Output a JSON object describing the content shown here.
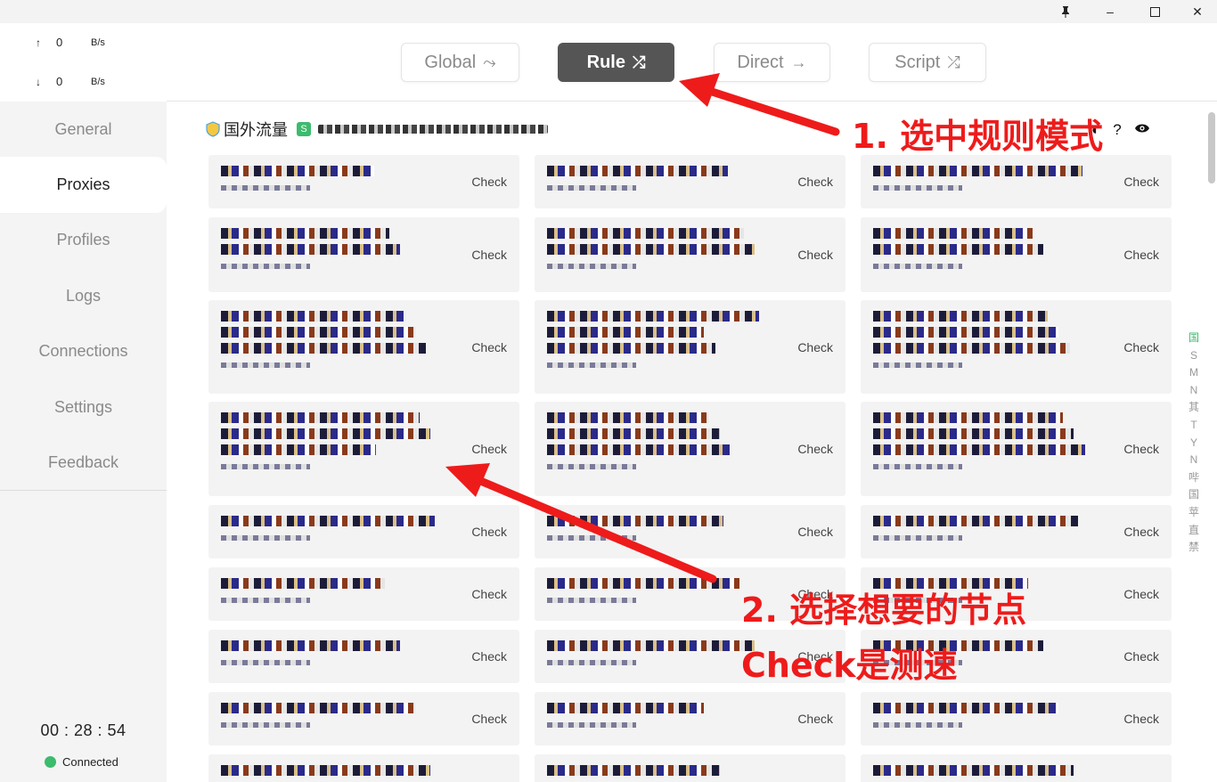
{
  "window": {
    "controls": {
      "pin": "📌",
      "minimize": "–",
      "maximize": "☐",
      "close": "✕"
    }
  },
  "traffic": {
    "up": {
      "arrow": "↑",
      "value": "0",
      "unit": "B/s"
    },
    "down": {
      "arrow": "↓",
      "value": "0",
      "unit": "B/s"
    }
  },
  "sidebar": {
    "items": [
      {
        "label": "General"
      },
      {
        "label": "Proxies"
      },
      {
        "label": "Profiles"
      },
      {
        "label": "Logs"
      },
      {
        "label": "Connections"
      },
      {
        "label": "Settings"
      },
      {
        "label": "Feedback"
      }
    ],
    "active": "Proxies",
    "timer": "00 : 28 : 54",
    "status": "Connected"
  },
  "modes": [
    {
      "label": "Global",
      "icon": "⤳"
    },
    {
      "label": "Rule",
      "icon": "⤮"
    },
    {
      "label": "Direct",
      "icon": "→"
    },
    {
      "label": "Script",
      "icon": "⤮"
    }
  ],
  "active_mode": "Rule",
  "group": {
    "title": "国外流量",
    "badge": "S"
  },
  "check_label": "Check",
  "index_letters": [
    "国",
    "S",
    "M",
    "N",
    "其",
    "T",
    "Y",
    "N",
    "哔",
    "国",
    "苹",
    "直",
    "禁"
  ],
  "annotations": {
    "step1": "1. 选中规则模式",
    "step2": "2. 选择想要的节点",
    "step3": "Check是测速"
  },
  "colors": {
    "accent_green": "#3dbb6e",
    "active_mode_bg": "#555555",
    "annotation_red": "#ee1b1b"
  }
}
